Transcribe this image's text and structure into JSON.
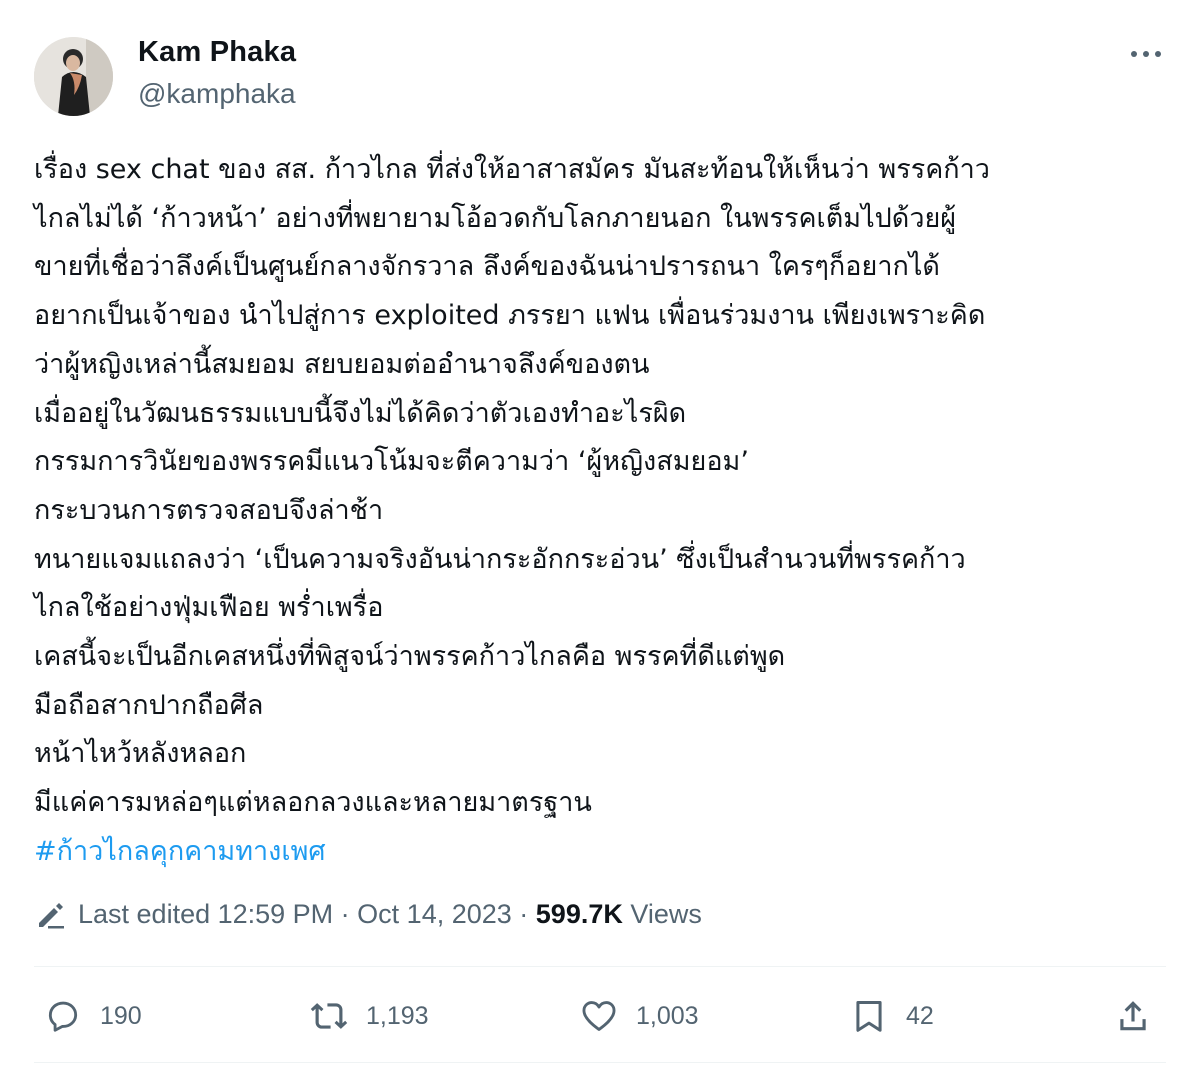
{
  "author": {
    "name": "Kam Phaka",
    "handle": "@kamphaka"
  },
  "tweet": {
    "lines": [
      "เรื่อง sex chat ของ สส. ก้าวไกล ที่ส่งให้อาสาสมัคร มันสะท้อนให้เห็นว่า พรรคก้าว",
      "ไกลไม่ได้ ‘ก้าวหน้า’ อย่างที่พยายามโอ้อวดกับโลกภายนอก ในพรรคเต็มไปด้วยผู้",
      "ขายที่เชื่อว่าลึงค์เป็นศูนย์กลางจักรวาล ลึงค์ของฉันน่าปรารถนา ใครๆก็อยากได้",
      "อยากเป็นเจ้าของ นำไปสู่การ exploited ภรรยา แฟน เพื่อนร่วมงาน เพียงเพราะคิด",
      "ว่าผู้หญิงเหล่านี้สมยอม สยบยอมต่ออำนาจลึงค์ของตน",
      "เมื่ออยู่ในวัฒนธรรมแบบนี้จึงไม่ได้คิดว่าตัวเองทำอะไรผิด",
      "กรรมการวินัยของพรรคมีแนวโน้มจะตีความว่า ‘ผู้หญิงสมยอม’",
      "กระบวนการตรวจสอบจึงล่าช้า",
      "ทนายแจมแถลงว่า ‘เป็นความจริงอันน่ากระอักกระอ่วน’ ซึ่งเป็นสำนวนที่พรรคก้าว",
      "ไกลใช้อย่างฟุ่มเฟือย พร่ำเพรื่อ",
      "เคสนี้จะเป็นอีกเคสหนึ่งที่พิสูจน์ว่าพรรคก้าวไกลคือ พรรคที่ดีแต่พูด",
      "มือถือสากปากถือศีล",
      "หน้าไหว้หลังหลอก",
      "มีแค่คารมหล่อๆแต่หลอกลวงและหลายมาตรฐาน"
    ],
    "hashtag": "#ก้าวไกลคุกคามทางเพศ"
  },
  "meta": {
    "edited": "Last edited 12:59 PM",
    "sep1": " · ",
    "date": "Oct 14, 2023",
    "sep2": " · ",
    "views_count": "599.7K",
    "views_label": " Views"
  },
  "actions": {
    "replies": "190",
    "retweets": "1,193",
    "likes": "1,003",
    "bookmarks": "42"
  },
  "colors": {
    "text": "#0f1419",
    "secondary": "#536471",
    "link": "#1d9bf0",
    "divider": "#eff3f4"
  }
}
